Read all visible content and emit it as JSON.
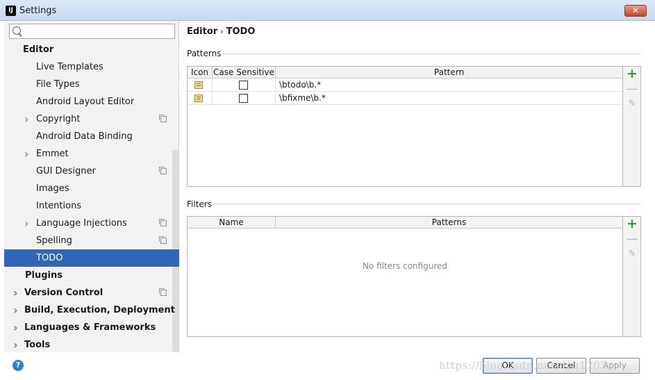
{
  "window": {
    "title": "Settings",
    "app_icon_text": "IJ",
    "close_label": "✕"
  },
  "search": {
    "placeholder": "",
    "value": ""
  },
  "sidebar": {
    "items": [
      {
        "label": "Editor",
        "level": 0,
        "bold": true,
        "chevron": false,
        "copy": false,
        "selected": false
      },
      {
        "label": "Live Templates",
        "level": 1,
        "bold": false,
        "chevron": false,
        "copy": false,
        "selected": false
      },
      {
        "label": "File Types",
        "level": 1,
        "bold": false,
        "chevron": false,
        "copy": false,
        "selected": false
      },
      {
        "label": "Android Layout Editor",
        "level": 1,
        "bold": false,
        "chevron": false,
        "copy": false,
        "selected": false
      },
      {
        "label": "Copyright",
        "level": 1,
        "bold": false,
        "chevron": true,
        "copy": true,
        "selected": false
      },
      {
        "label": "Android Data Binding",
        "level": 1,
        "bold": false,
        "chevron": false,
        "copy": false,
        "selected": false
      },
      {
        "label": "Emmet",
        "level": 1,
        "bold": false,
        "chevron": true,
        "copy": false,
        "selected": false
      },
      {
        "label": "GUI Designer",
        "level": 1,
        "bold": false,
        "chevron": false,
        "copy": true,
        "selected": false
      },
      {
        "label": "Images",
        "level": 1,
        "bold": false,
        "chevron": false,
        "copy": false,
        "selected": false
      },
      {
        "label": "Intentions",
        "level": 1,
        "bold": false,
        "chevron": false,
        "copy": false,
        "selected": false
      },
      {
        "label": "Language Injections",
        "level": 1,
        "bold": false,
        "chevron": true,
        "copy": true,
        "selected": false
      },
      {
        "label": "Spelling",
        "level": 1,
        "bold": false,
        "chevron": false,
        "copy": true,
        "selected": false
      },
      {
        "label": "TODO",
        "level": 1,
        "bold": false,
        "chevron": false,
        "copy": false,
        "selected": true
      },
      {
        "label": "Plugins",
        "level": 0,
        "bold": true,
        "chevron": false,
        "copy": false,
        "selected": false
      },
      {
        "label": "Version Control",
        "level": 0,
        "bold": true,
        "chevron": true,
        "copy": true,
        "selected": false
      },
      {
        "label": "Build, Execution, Deployment",
        "level": 0,
        "bold": true,
        "chevron": true,
        "copy": false,
        "selected": false
      },
      {
        "label": "Languages & Frameworks",
        "level": 0,
        "bold": true,
        "chevron": true,
        "copy": false,
        "selected": false
      },
      {
        "label": "Tools",
        "level": 0,
        "bold": true,
        "chevron": true,
        "copy": false,
        "selected": false
      }
    ]
  },
  "breadcrumb": {
    "parent": "Editor",
    "separator": "›",
    "current": "TODO"
  },
  "patterns": {
    "title": "Patterns",
    "columns": [
      "Icon",
      "Case Sensitive",
      "Pattern"
    ],
    "rows": [
      {
        "icon": "todo-note-icon",
        "case_sensitive": false,
        "pattern": "\\btodo\\b.*"
      },
      {
        "icon": "todo-note-icon",
        "case_sensitive": false,
        "pattern": "\\bfixme\\b.*"
      }
    ]
  },
  "filters": {
    "title": "Filters",
    "columns": [
      "Name",
      "Patterns"
    ],
    "empty_text": "No filters configured"
  },
  "toolbar_icons": {
    "add": "+",
    "remove": "—",
    "edit": "✎"
  },
  "footer": {
    "help_label": "?",
    "ok_label": "OK",
    "cancel_label": "Cancel",
    "apply_label": "Apply",
    "watermark": "https://blog.csdn.net/dyq1203"
  },
  "colors": {
    "selection": "#2f66b8",
    "add_icon": "#3a9a35"
  }
}
